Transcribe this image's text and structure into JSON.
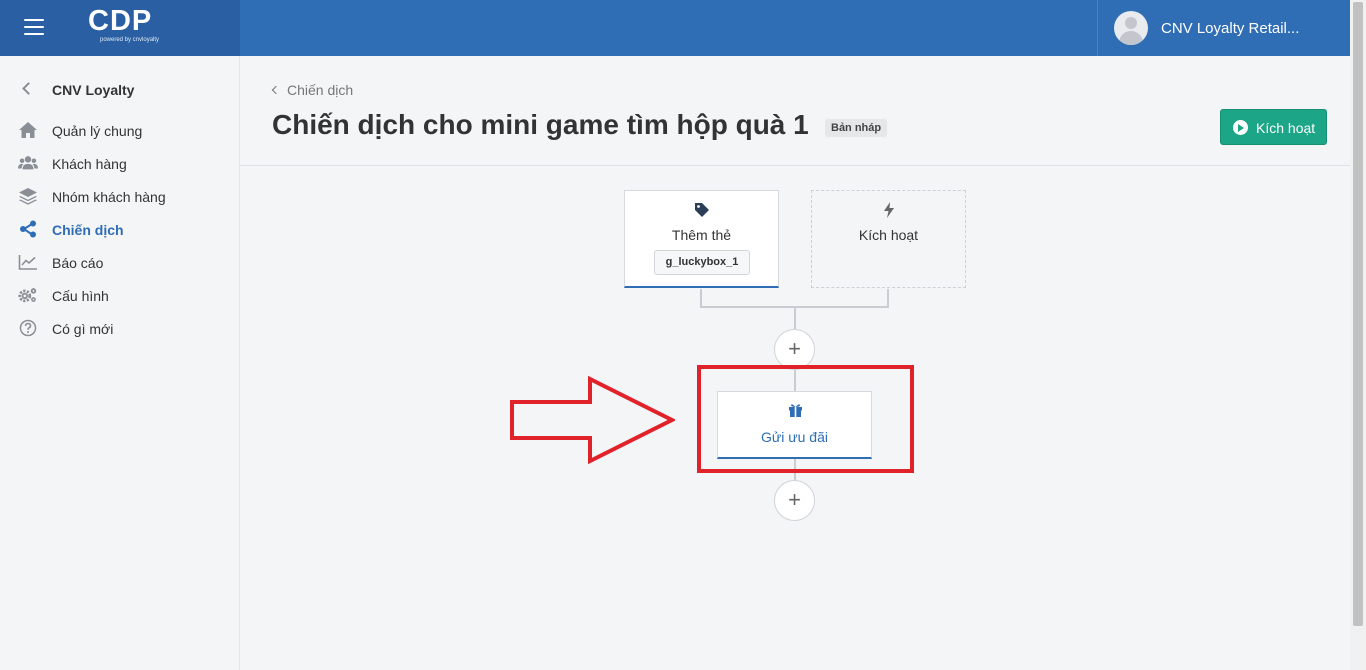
{
  "header": {
    "menu_icon": "hamburger-icon",
    "logo_text": "CDP",
    "logo_subtext": "powered by cnvloyalty",
    "user_name": "CNV Loyalty Retail...",
    "avatar_icon": "user-avatar-icon",
    "bar_color": "#2f6db5"
  },
  "sidebar": {
    "back_icon": "chevron-left-icon",
    "title": "CNV Loyalty",
    "items": [
      {
        "label": "Quản lý chung",
        "icon": "home-icon"
      },
      {
        "label": "Khách hàng",
        "icon": "users-icon"
      },
      {
        "label": "Nhóm khách hàng",
        "icon": "layers-icon"
      },
      {
        "label": "Chiến dịch",
        "icon": "share-icon",
        "active": true
      },
      {
        "label": "Báo cáo",
        "icon": "chart-line-icon"
      },
      {
        "label": "Cấu hình",
        "icon": "cogs-icon"
      },
      {
        "label": "Có gì mới",
        "icon": "question-circle-icon"
      }
    ]
  },
  "main": {
    "breadcrumb": "Chiến dịch",
    "title": "Chiến dịch cho mini game tìm hộp quà 1",
    "status_badge": "Bản nháp",
    "activate_button": "Kích hoạt",
    "accent_color": "#1ca587"
  },
  "flow": {
    "trigger_card": {
      "label": "Thêm thẻ",
      "tag": "g_luckybox_1",
      "icon": "tag-icon"
    },
    "empty_card": {
      "label": "Kích hoạt",
      "icon": "bolt-icon"
    },
    "add_step_symbol": "+",
    "action_card": {
      "label": "Gửi ưu đãi",
      "icon": "gift-icon"
    },
    "highlight_color": "#e0232b"
  }
}
